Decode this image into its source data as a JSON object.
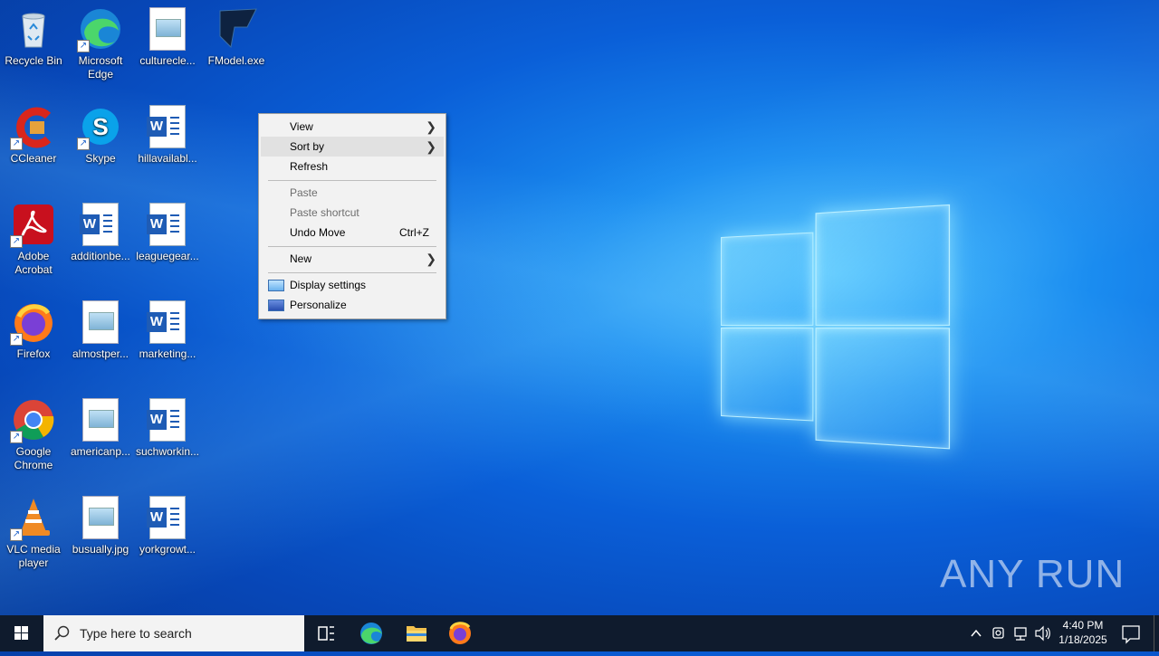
{
  "desktop": {
    "icons": [
      {
        "label": "Recycle Bin",
        "icon": "recycle-bin-icon"
      },
      {
        "label": "Microsoft Edge",
        "icon": "edge-icon"
      },
      {
        "label": "culturecle...",
        "icon": "image-file-icon"
      },
      {
        "label": "FModel.exe",
        "icon": "fmodel-icon"
      },
      {
        "label": "CCleaner",
        "icon": "ccleaner-icon"
      },
      {
        "label": "Skype",
        "icon": "skype-icon"
      },
      {
        "label": "hillavailabl...",
        "icon": "word-doc-icon"
      },
      {
        "label": "Adobe Acrobat",
        "icon": "acrobat-icon"
      },
      {
        "label": "additionbe...",
        "icon": "word-doc-icon"
      },
      {
        "label": "leaguegear...",
        "icon": "word-doc-icon"
      },
      {
        "label": "Firefox",
        "icon": "firefox-icon"
      },
      {
        "label": "almostper...",
        "icon": "image-file-icon"
      },
      {
        "label": "marketing...",
        "icon": "word-doc-icon"
      },
      {
        "label": "Google Chrome",
        "icon": "chrome-icon"
      },
      {
        "label": "americanp...",
        "icon": "image-file-icon"
      },
      {
        "label": "suchworkin...",
        "icon": "word-doc-icon"
      },
      {
        "label": "VLC media player",
        "icon": "vlc-icon"
      },
      {
        "label": "busually.jpg",
        "icon": "image-file-icon"
      },
      {
        "label": "yorkgrowt...",
        "icon": "word-doc-icon"
      }
    ]
  },
  "context_menu": {
    "view": "View",
    "sort_by": "Sort by",
    "refresh": "Refresh",
    "paste": "Paste",
    "paste_shortcut": "Paste shortcut",
    "undo_move": "Undo Move",
    "undo_shortcut": "Ctrl+Z",
    "new": "New",
    "display_settings": "Display settings",
    "personalize": "Personalize"
  },
  "taskbar": {
    "search_placeholder": "Type here to search",
    "time": "4:40 PM",
    "date": "1/18/2025"
  },
  "watermark": "ANY RUN",
  "colors": {
    "taskbar": "#0f1b2d",
    "menu_bg": "#f2f2f2",
    "menu_highlight": "#e1e1e1"
  }
}
